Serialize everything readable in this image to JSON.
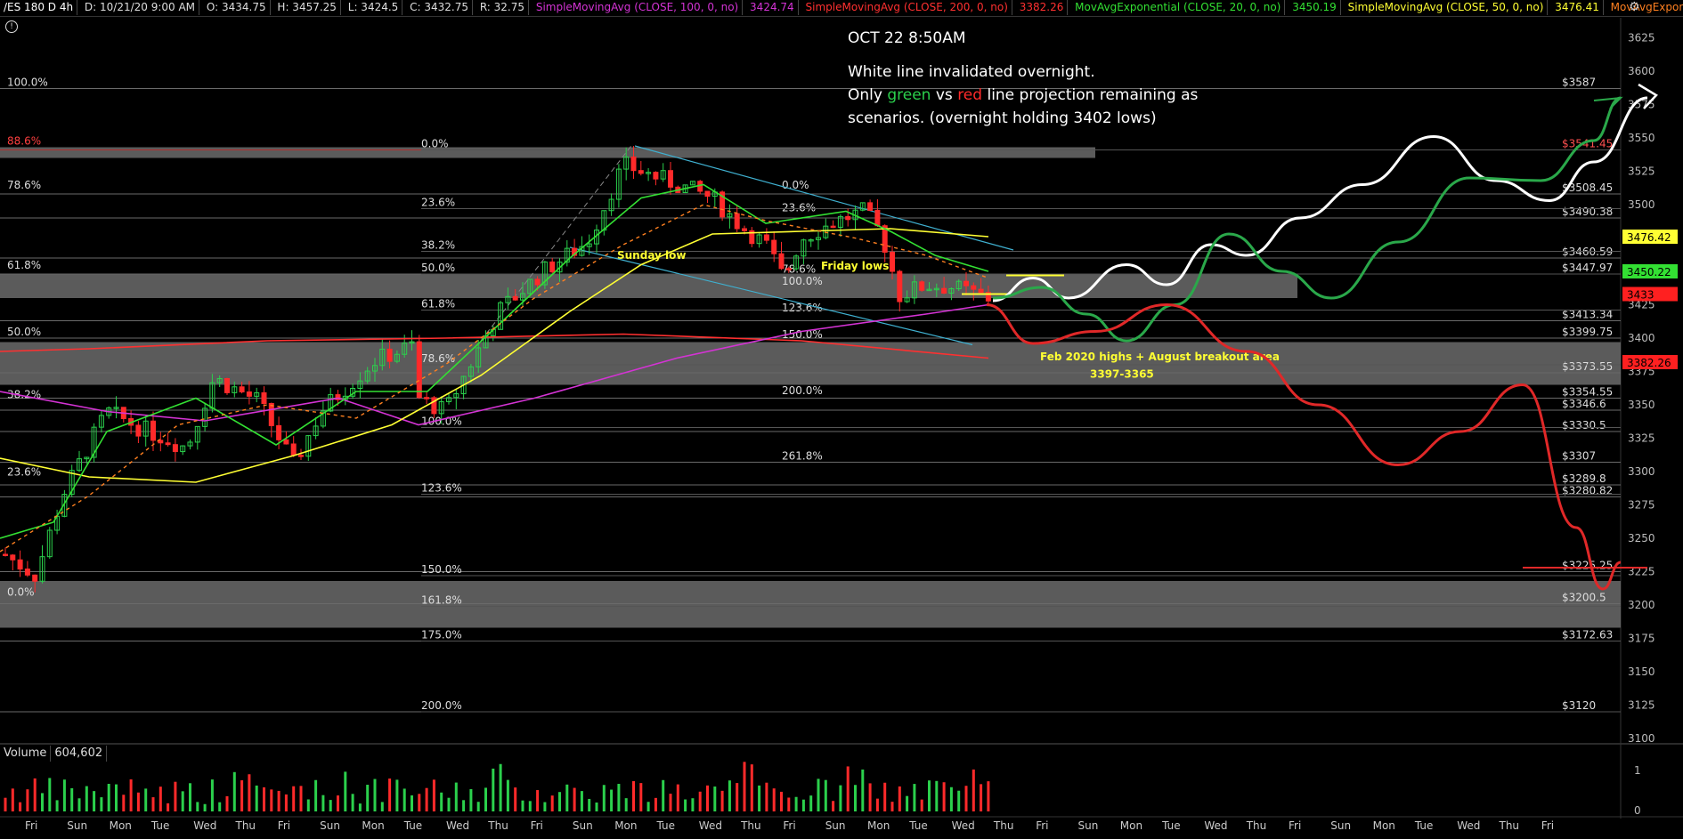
{
  "header": {
    "symbol": "/ES 180 D 4h",
    "date": "D: 10/21/20 9:00 AM",
    "open": "O: 3434.75",
    "high": "H: 3457.25",
    "low": "L: 3424.5",
    "close": "C: 3432.75",
    "range": "R: 32.75",
    "studies": [
      {
        "label": "SimpleMovingAvg (CLOSE, 100, 0, no)",
        "value": "3424.74",
        "color": "#d433d4"
      },
      {
        "label": "SimpleMovingAvg (CLOSE, 200, 0, no)",
        "value": "3382.26",
        "color": "#ff3030"
      },
      {
        "label": "MovAvgExponential (CLOSE, 20, 0, no)",
        "value": "3450.19",
        "color": "#33e033"
      },
      {
        "label": "SimpleMovingAvg (CLOSE, 50, 0, no)",
        "value": "3476.41",
        "color": "#ffff33"
      },
      {
        "label": "MovAvgExponential ...",
        "value": "",
        "color": "#ff8020"
      }
    ]
  },
  "annotation": {
    "time": "OCT 22 8:50AM",
    "line1": "White line invalidated overnight.",
    "line2_a": "Only ",
    "line2_green": "green",
    "line2_b": " vs ",
    "line2_red": "red",
    "line2_c": " line projection remaining as",
    "line3": "scenarios. (overnight holding 3402 lows)"
  },
  "volume": {
    "label": "Volume",
    "value": "604,602"
  },
  "chart_data": {
    "type": "candlestick",
    "y_axis_range": [
      3100,
      3640
    ],
    "y_ticks": [
      3100,
      3125,
      3150,
      3175,
      3200,
      3225,
      3250,
      3275,
      3300,
      3325,
      3350,
      3375,
      3400,
      3425,
      3450,
      3475,
      3500,
      3525,
      3550,
      3575,
      3600,
      3625
    ],
    "x_ticks": [
      "Fri",
      "Sun",
      "Mon",
      "Tue",
      "Wed",
      "Thu",
      "Fri",
      "Sun",
      "Mon",
      "Tue",
      "Wed",
      "Thu",
      "Fri",
      "Sun",
      "Mon",
      "Tue",
      "Wed",
      "Thu",
      "Fri",
      "Sun",
      "Mon",
      "Tue",
      "Wed",
      "Thu",
      "Fri",
      "Sun",
      "Mon",
      "Tue",
      "Wed",
      "Thu",
      "Fri",
      "Sun",
      "Mon",
      "Tue",
      "Wed",
      "Thu",
      "Fri"
    ],
    "price_labels_right": [
      {
        "text": "$3587",
        "y": 3587,
        "color": "#ddd"
      },
      {
        "text": "$3541.45",
        "y": 3541,
        "color": "#ff5050"
      },
      {
        "text": "$3508.45",
        "y": 3508,
        "color": "#ddd"
      },
      {
        "text": "$3490.38",
        "y": 3490,
        "color": "#ddd"
      },
      {
        "text": "$3460.59",
        "y": 3460,
        "color": "#ddd"
      },
      {
        "text": "$3447.97",
        "y": 3448,
        "color": "#ddd"
      },
      {
        "text": "$3413.34",
        "y": 3413,
        "color": "#ddd"
      },
      {
        "text": "$3399.75",
        "y": 3400,
        "color": "#ddd"
      },
      {
        "text": "$3373.55",
        "y": 3374,
        "color": "#ddd"
      },
      {
        "text": "$3354.55",
        "y": 3355,
        "color": "#ddd"
      },
      {
        "text": "$3346.6",
        "y": 3346,
        "color": "#ddd"
      },
      {
        "text": "$3330.5",
        "y": 3330,
        "color": "#ddd"
      },
      {
        "text": "$3307",
        "y": 3307,
        "color": "#ddd"
      },
      {
        "text": "$3289.8",
        "y": 3290,
        "color": "#ddd"
      },
      {
        "text": "$3280.82",
        "y": 3281,
        "color": "#ddd"
      },
      {
        "text": "$3225.25",
        "y": 3225,
        "color": "#ddd"
      },
      {
        "text": "$3200.5",
        "y": 3201,
        "color": "#ddd"
      },
      {
        "text": "$3172.63",
        "y": 3173,
        "color": "#ddd"
      },
      {
        "text": "$3120",
        "y": 3120,
        "color": "#ddd"
      }
    ],
    "axis_badges": [
      {
        "text": "3476.42",
        "y": 3476,
        "bg": "#ffff33",
        "fg": "#000"
      },
      {
        "text": "3450.22",
        "y": 3450,
        "bg": "#33e033",
        "fg": "#000"
      },
      {
        "text": "3433",
        "y": 3433,
        "bg": "#ff2020",
        "fg": "#000"
      },
      {
        "text": "3382.26",
        "y": 3382,
        "bg": "#ff2020",
        "fg": "#000"
      }
    ],
    "fib_left": [
      {
        "text": "100.0%",
        "y": 3587,
        "color": "#ddd"
      },
      {
        "text": "88.6%",
        "y": 3543,
        "color": "#ff4040"
      },
      {
        "text": "78.6%",
        "y": 3510,
        "color": "#ddd"
      },
      {
        "text": "61.8%",
        "y": 3450,
        "color": "#ddd"
      },
      {
        "text": "50.0%",
        "y": 3400,
        "color": "#ddd"
      },
      {
        "text": "38.2%",
        "y": 3353,
        "color": "#ddd"
      },
      {
        "text": "23.6%",
        "y": 3295,
        "color": "#ddd"
      },
      {
        "text": "0.0%",
        "y": 3205,
        "color": "#ddd"
      }
    ],
    "fib_mid": [
      {
        "text": "0.0%",
        "y": 3541,
        "color": "#ddd"
      },
      {
        "text": "23.6%",
        "y": 3497,
        "color": "#ddd"
      },
      {
        "text": "38.2%",
        "y": 3465,
        "color": "#ddd"
      },
      {
        "text": "50.0%",
        "y": 3448,
        "color": "#ddd"
      },
      {
        "text": "61.8%",
        "y": 3421,
        "color": "#ddd"
      },
      {
        "text": "78.6%",
        "y": 3380,
        "color": "#ddd"
      },
      {
        "text": "100.0%",
        "y": 3333,
        "color": "#ddd"
      },
      {
        "text": "123.6%",
        "y": 3283,
        "color": "#ddd"
      },
      {
        "text": "150.0%",
        "y": 3222,
        "color": "#ddd"
      },
      {
        "text": "161.8%",
        "y": 3199,
        "color": "#ddd"
      },
      {
        "text": "175.0%",
        "y": 3173,
        "color": "#ddd"
      },
      {
        "text": "200.0%",
        "y": 3120,
        "color": "#ddd"
      }
    ],
    "fib_right": [
      {
        "text": "0.0%",
        "y": 3510,
        "color": "#ddd"
      },
      {
        "text": "23.6%",
        "y": 3493,
        "color": "#ddd"
      },
      {
        "text": "78.6%",
        "y": 3447,
        "color": "#ddd"
      },
      {
        "text": "100.0%",
        "y": 3438,
        "color": "#ddd"
      },
      {
        "text": "123.6%",
        "y": 3418,
        "color": "#ddd"
      },
      {
        "text": "150.0%",
        "y": 3398,
        "color": "#ddd"
      },
      {
        "text": "200.0%",
        "y": 3356,
        "color": "#ddd"
      },
      {
        "text": "261.8%",
        "y": 3307,
        "color": "#ddd"
      }
    ],
    "text_labels": [
      {
        "text": "Sunday low",
        "y": 3462,
        "color": "#ffff33"
      },
      {
        "text": "Friday lows",
        "y": 3454,
        "color": "#ffff33"
      },
      {
        "text": "Feb 2020 highs + August breakout area",
        "y": 3386,
        "color": "#ffff33"
      },
      {
        "text": "3397-3365",
        "y": 3373,
        "color": "#ffff33"
      }
    ],
    "zones": [
      {
        "from": 3535,
        "to": 3543
      },
      {
        "from": 3430,
        "to": 3448
      },
      {
        "from": 3365,
        "to": 3397
      },
      {
        "from": 3183,
        "to": 3218
      }
    ],
    "volume_axis": [
      "1",
      "0"
    ]
  }
}
